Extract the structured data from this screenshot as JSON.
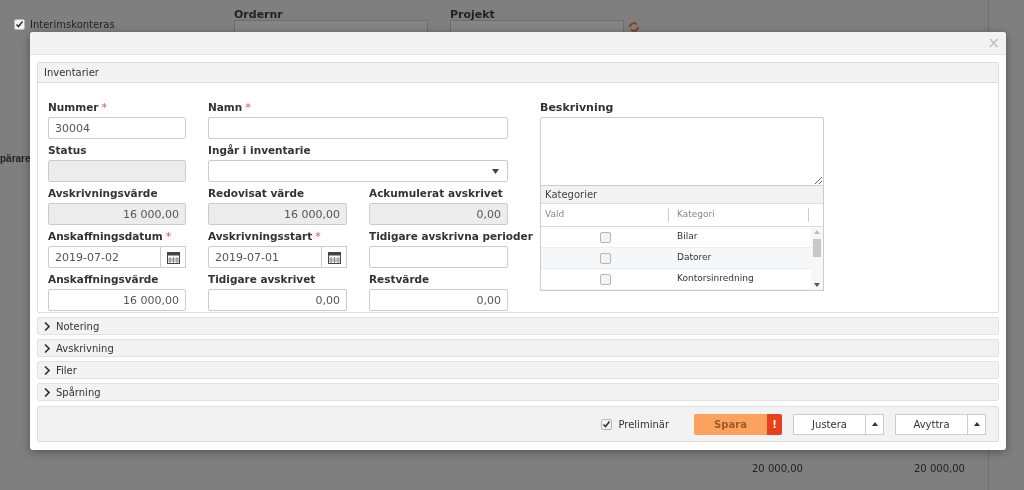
{
  "background": {
    "interim": {
      "label": "Interimskonteras",
      "checked": true
    },
    "ordernr": {
      "label": "Ordernr"
    },
    "projekt": {
      "label": "Projekt"
    },
    "side_text": "pärare",
    "totals": [
      "20 000,00",
      "20 000,00"
    ]
  },
  "dialog": {
    "close": "×",
    "panel": {
      "title": "Inventarier",
      "rows": [
        [
          {
            "label": "Nummer",
            "required_mark": "*",
            "kind": "text",
            "value": "30004",
            "disabled": false
          },
          {
            "label": "Namn",
            "required_mark": "*",
            "kind": "text",
            "disabled": false
          }
        ],
        [
          {
            "label": "Status",
            "kind": "text",
            "disabled": true
          },
          {
            "label": "Ingår i inventarie",
            "kind": "select",
            "disabled": false
          }
        ],
        [
          {
            "label": "Avskrivningsvärde",
            "kind": "number",
            "value": "16 000,00",
            "disabled": true
          },
          {
            "label": "Redovisat värde",
            "kind": "number",
            "value": "16 000,00",
            "disabled": true
          },
          {
            "label": "Ackumulerat avskrivet",
            "kind": "number",
            "value": "0,00",
            "disabled": true
          }
        ],
        [
          {
            "label": "Anskaffningsdatum",
            "required_mark": "*",
            "kind": "date",
            "value": "2019-07-02",
            "disabled": false
          },
          {
            "label": "Avskrivningsstart",
            "required_mark": "*",
            "kind": "date",
            "value": "2019-07-01",
            "disabled": false
          },
          {
            "label": "Tidigare avskrivna perioder",
            "kind": "text",
            "disabled": false
          }
        ],
        [
          {
            "label": "Anskaffningsvärde",
            "kind": "number",
            "value": "16 000,00",
            "disabled": false
          },
          {
            "label": "Tidigare avskrivet",
            "kind": "number",
            "value": "0,00",
            "disabled": false
          },
          {
            "label": "Restvärde",
            "kind": "number",
            "value": "0,00",
            "disabled": false
          }
        ]
      ],
      "description": {
        "label": "Beskrivning"
      },
      "categories": {
        "title": "Kategorier",
        "columns": [
          "Vald",
          "Kategori"
        ],
        "rows": [
          {
            "label": "Bilar",
            "checked": false
          },
          {
            "label": "Datorer",
            "checked": false
          },
          {
            "label": "Kontorsinredning",
            "checked": false
          }
        ]
      }
    },
    "sections": [
      {
        "label": "Notering",
        "expanded": false
      },
      {
        "label": "Avskrivning",
        "expanded": false
      },
      {
        "label": "Filer",
        "expanded": false
      },
      {
        "label": "Spårning",
        "expanded": false
      }
    ],
    "footer": {
      "preliminary": {
        "label": "Preliminär",
        "checked": true
      },
      "buttons": [
        {
          "label": "Spara",
          "kind": "primary",
          "alert": "!"
        },
        {
          "label": "Justera",
          "kind": "split"
        },
        {
          "label": "Avyttra",
          "kind": "split"
        }
      ]
    }
  }
}
